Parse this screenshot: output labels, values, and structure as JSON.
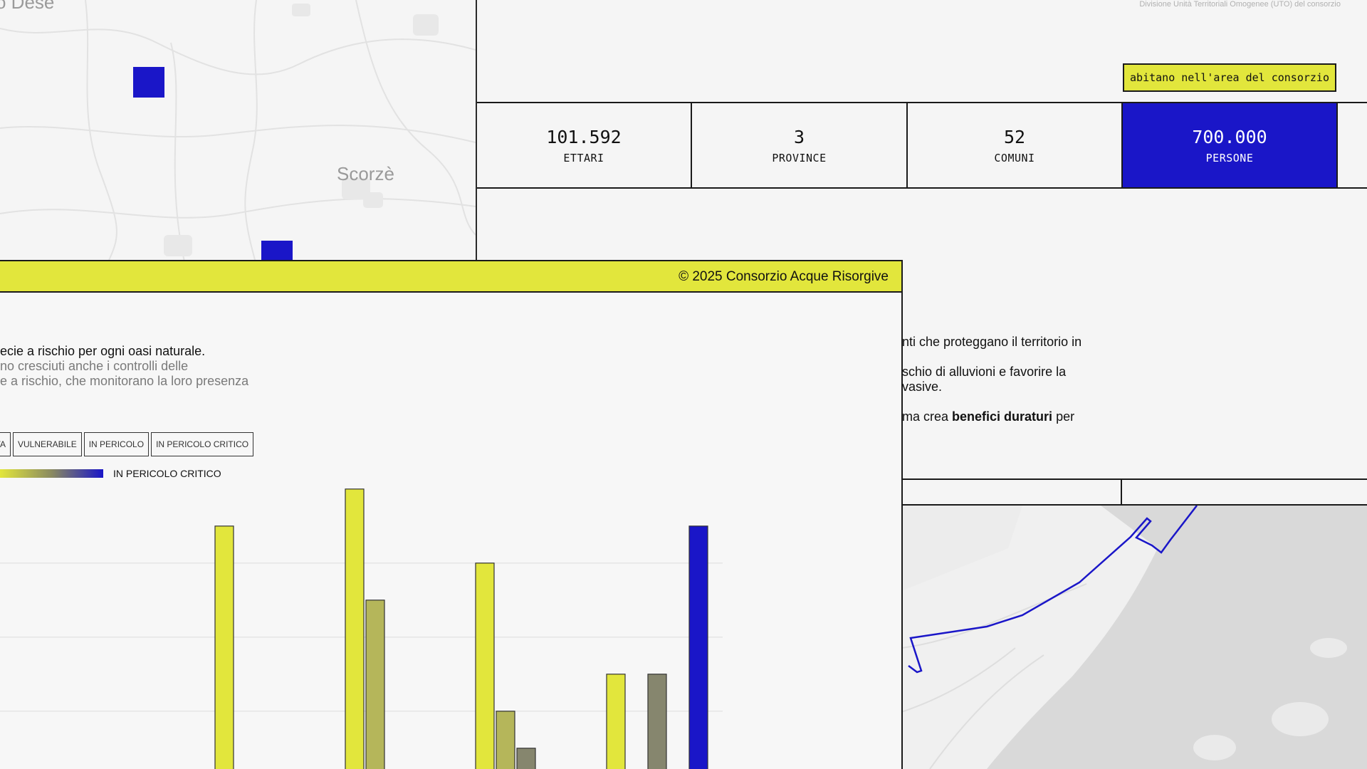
{
  "top_map": {
    "place_label": "Scorzè",
    "partial_place_label": "o Dese"
  },
  "right_panel": {
    "legend_note": "Divisione Unità Territoriali Omogenee (UTO) del consorzio",
    "inhabit_badge": "abitano nell'area del consorzio",
    "stats": [
      {
        "value": "101.592",
        "label": "ETTARI"
      },
      {
        "value": "3",
        "label": "PROVINCE"
      },
      {
        "value": "52",
        "label": "COMUNI"
      },
      {
        "value": "700.000",
        "label": "PERSONE"
      }
    ],
    "text": {
      "p1": "nti che proteggano il territorio in",
      "p2a": "schio di alluvioni e favorire la",
      "p2b": "vasive.",
      "p3_pre": "ma crea ",
      "p3_bold": "benefici duraturi",
      "p3_post": " per"
    }
  },
  "front_window": {
    "copyright": "© 2025 Consorzio Acque Risorgive",
    "intro": {
      "line1": "ecie a rischio per ogni oasi naturale.",
      "line2": "no cresciuti anche i controlli delle",
      "line3": "e a rischio, che monitorano la loro presenza"
    },
    "filters": [
      "TA",
      "VULNERABILE",
      "IN PERICOLO",
      "IN PERICOLO CRITICO"
    ],
    "gradient_label": "IN PERICOLO CRITICO"
  },
  "colors": {
    "accent_blue": "#1a16c8",
    "accent_yellow": "#e2e63c",
    "olive": "#b5b65a",
    "grey_olive": "#86866e"
  },
  "chart_data": {
    "type": "bar",
    "series_colors": [
      "#e2e63c",
      "#b5b65a",
      "#86866e",
      "#1a16c8"
    ],
    "groups": [
      {
        "bars": [
          {
            "value": 6.6,
            "color": 0
          }
        ]
      },
      {
        "bars": [
          {
            "value": 7.6,
            "color": 0
          },
          {
            "value": 4.6,
            "color": 1
          }
        ]
      },
      {
        "bars": [
          {
            "value": 5.6,
            "color": 0
          },
          {
            "value": 1.6,
            "color": 1
          },
          {
            "value": 0.6,
            "color": 2
          }
        ]
      },
      {
        "bars": [
          {
            "value": 2.6,
            "color": 0
          },
          {
            "value": 2.6,
            "color": 2
          },
          {
            "value": 6.6,
            "color": 3
          }
        ]
      }
    ],
    "ylim": [
      0,
      7.6
    ],
    "grid": true
  }
}
